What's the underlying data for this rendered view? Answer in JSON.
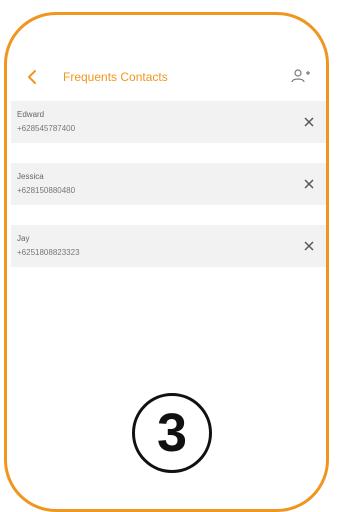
{
  "header": {
    "title": "Frequents Contacts",
    "back_icon": "chevron-left-icon",
    "add_icon": "add-person-icon"
  },
  "contacts": [
    {
      "name": "Edward",
      "phone": "+628545787400"
    },
    {
      "name": "Jessica",
      "phone": "+628150880480"
    },
    {
      "name": "Jay",
      "phone": "+6251808823323"
    }
  ],
  "remove_icon": "close-icon",
  "step_label": "3",
  "colors": {
    "accent": "#f0961e",
    "row_background": "#f2f2f2",
    "text_secondary": "#777777"
  }
}
